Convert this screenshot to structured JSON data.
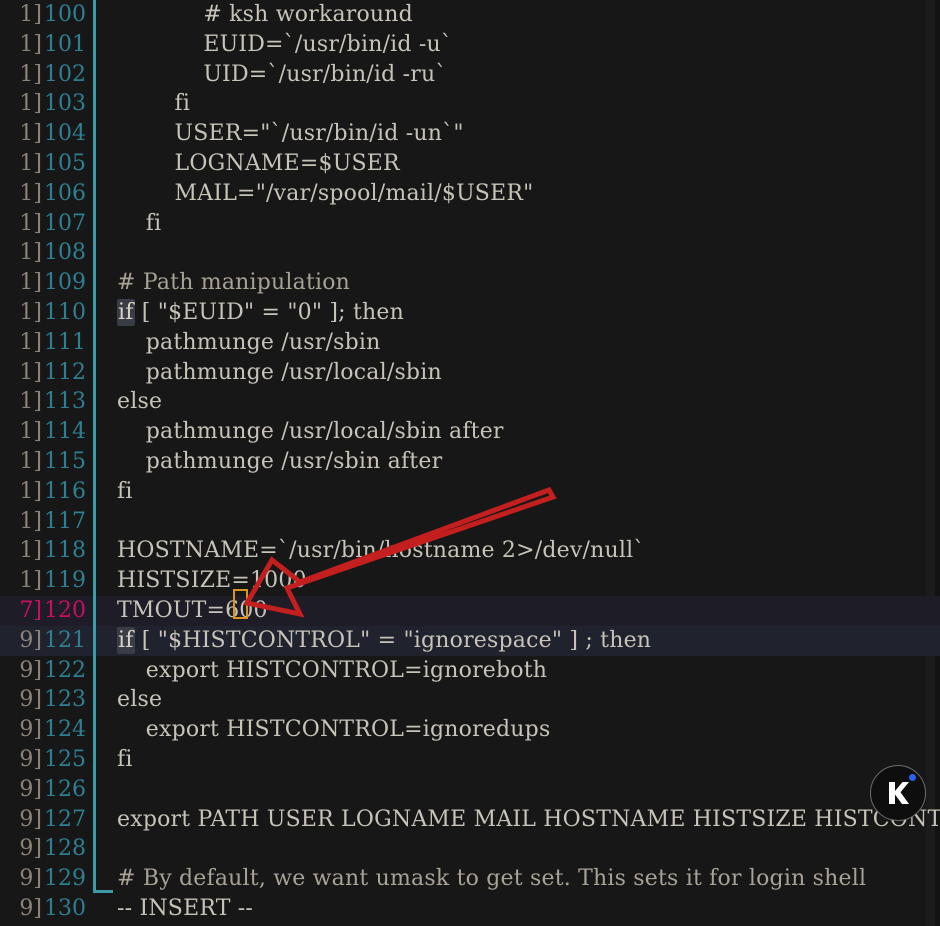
{
  "app": {
    "name": "vim",
    "mode_indicator": "-- INSERT --",
    "theme": {
      "background": "#171717",
      "text": "#c7c3b8",
      "linenumber": "#2f7f92",
      "linenumber_current": "#c7105f",
      "current_line_bg": "#1e1c26",
      "search_line_bg": "#20222e",
      "indent_guide": "#3d9aa8",
      "cursor": "#d89321",
      "annotation_arrow": "#c41f1f"
    }
  },
  "annotation": {
    "arrow_name": "red-arrow-pointing-to-cursor",
    "arrow_color": "#c41f1f",
    "points_at": "TMOUT=600 cursor on line 120"
  },
  "badge": {
    "letter": "K",
    "dot_color": "#2563eb",
    "ring_color": "#6e6e6e"
  },
  "cursor": {
    "line": 120,
    "column": 10,
    "after_text": "TMOUT=600"
  },
  "lines": [
    {
      "n": "100",
      "cut": "1]",
      "code": "            # ksh workaround",
      "state": "normal"
    },
    {
      "n": "101",
      "cut": "1]",
      "code": "            EUID=`/usr/bin/id -u`",
      "state": "normal"
    },
    {
      "n": "102",
      "cut": "1]",
      "code": "            UID=`/usr/bin/id -ru`",
      "state": "normal"
    },
    {
      "n": "103",
      "cut": "1]",
      "code": "        fi",
      "state": "normal"
    },
    {
      "n": "104",
      "cut": "1]",
      "code": "        USER=\"`/usr/bin/id -un`\"",
      "state": "normal"
    },
    {
      "n": "105",
      "cut": "1]",
      "code": "        LOGNAME=$USER",
      "state": "normal"
    },
    {
      "n": "106",
      "cut": "1]",
      "code": "        MAIL=\"/var/spool/mail/$USER\"",
      "state": "normal"
    },
    {
      "n": "107",
      "cut": "1]",
      "code": "    fi",
      "state": "normal"
    },
    {
      "n": "108",
      "cut": "1]",
      "code": "",
      "state": "normal"
    },
    {
      "n": "109",
      "cut": "1]",
      "code": "# Path manipulation",
      "state": "comment"
    },
    {
      "n": "110",
      "cut": "1]",
      "code": "if [ \"$EUID\" = \"0\" ]; then",
      "state": "kw"
    },
    {
      "n": "111",
      "cut": "1]",
      "code": "    pathmunge /usr/sbin",
      "state": "normal"
    },
    {
      "n": "112",
      "cut": "1]",
      "code": "    pathmunge /usr/local/sbin",
      "state": "normal"
    },
    {
      "n": "113",
      "cut": "1]",
      "code": "else",
      "state": "normal"
    },
    {
      "n": "114",
      "cut": "1]",
      "code": "    pathmunge /usr/local/sbin after",
      "state": "normal"
    },
    {
      "n": "115",
      "cut": "1]",
      "code": "    pathmunge /usr/sbin after",
      "state": "normal"
    },
    {
      "n": "116",
      "cut": "1]",
      "code": "fi",
      "state": "normal"
    },
    {
      "n": "117",
      "cut": "1]",
      "code": "",
      "state": "normal"
    },
    {
      "n": "118",
      "cut": "1]",
      "code": "HOSTNAME=`/usr/bin/hostname 2>/dev/null`",
      "state": "normal"
    },
    {
      "n": "119",
      "cut": "1]",
      "code": "HISTSIZE=1000",
      "state": "normal"
    },
    {
      "n": "120",
      "cut": "7]",
      "code": "TMOUT=600",
      "state": "current"
    },
    {
      "n": "121",
      "cut": "9]",
      "code": "if [ \"$HISTCONTROL\" = \"ignorespace\" ] ; then",
      "state": "search-kw"
    },
    {
      "n": "122",
      "cut": "9]",
      "code": "    export HISTCONTROL=ignoreboth",
      "state": "normal"
    },
    {
      "n": "123",
      "cut": "9]",
      "code": "else",
      "state": "normal"
    },
    {
      "n": "124",
      "cut": "9]",
      "code": "    export HISTCONTROL=ignoredups",
      "state": "normal"
    },
    {
      "n": "125",
      "cut": "9]",
      "code": "fi",
      "state": "normal"
    },
    {
      "n": "126",
      "cut": "9]",
      "code": "",
      "state": "normal"
    },
    {
      "n": "127",
      "cut": "9]",
      "code": "export PATH USER LOGNAME MAIL HOSTNAME HISTSIZE HISTCONTROL",
      "state": "normal"
    },
    {
      "n": "128",
      "cut": "9]",
      "code": "",
      "state": "normal"
    },
    {
      "n": "129",
      "cut": "9]",
      "code": "# By default, we want umask to get set. This sets it for login shell",
      "state": "comment"
    },
    {
      "n": "130",
      "cut": "9]",
      "code": "-- INSERT --",
      "state": "statusline"
    }
  ]
}
